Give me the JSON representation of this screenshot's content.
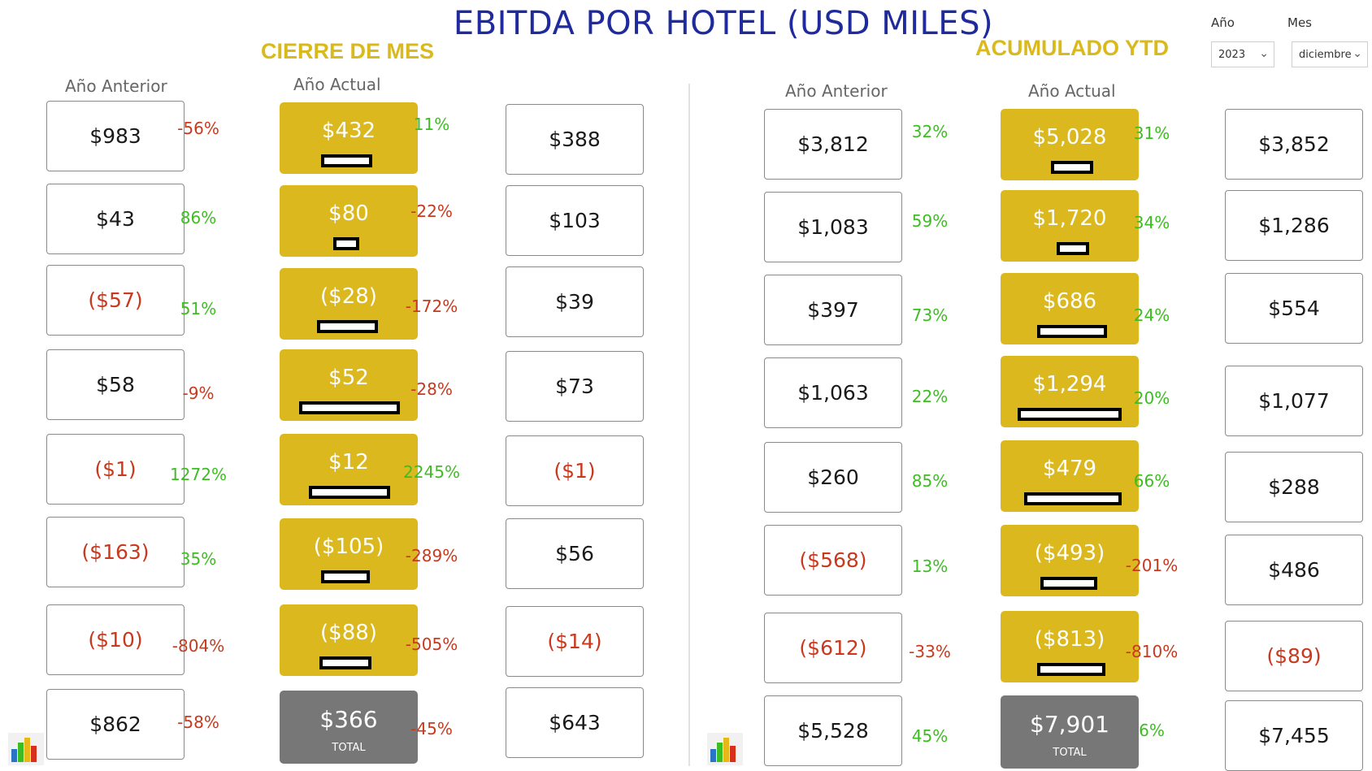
{
  "title": "EBITDA POR HOTEL (USD MILES)",
  "sections": {
    "mes": {
      "title": "CIERRE DE MES",
      "header_prev": "Año Anterior",
      "header_curr": "Año Actual",
      "rows": [
        {
          "prev": "$983",
          "prev_neg": false,
          "pct1": "-56%",
          "pct1_neg": true,
          "curr": "$432",
          "pct2": "11%",
          "pct2_neg": false,
          "right": "$388",
          "right_neg": false
        },
        {
          "prev": "$43",
          "prev_neg": false,
          "pct1": "86%",
          "pct1_neg": false,
          "curr": "$80",
          "pct2": "-22%",
          "pct2_neg": true,
          "right": "$103",
          "right_neg": false
        },
        {
          "prev": "($57)",
          "prev_neg": true,
          "pct1": "51%",
          "pct1_neg": false,
          "curr": "($28)",
          "pct2": "-172%",
          "pct2_neg": true,
          "right": "$39",
          "right_neg": false
        },
        {
          "prev": "$58",
          "prev_neg": false,
          "pct1": "-9%",
          "pct1_neg": true,
          "curr": "$52",
          "pct2": "-28%",
          "pct2_neg": true,
          "right": "$73",
          "right_neg": false
        },
        {
          "prev": "($1)",
          "prev_neg": true,
          "pct1": "1272%",
          "pct1_neg": false,
          "curr": "$12",
          "pct2": "2245%",
          "pct2_neg": false,
          "right": "($1)",
          "right_neg": true
        },
        {
          "prev": "($163)",
          "prev_neg": true,
          "pct1": "35%",
          "pct1_neg": false,
          "curr": "($105)",
          "pct2": "-289%",
          "pct2_neg": true,
          "right": "$56",
          "right_neg": false
        },
        {
          "prev": "($10)",
          "prev_neg": true,
          "pct1": "-804%",
          "pct1_neg": true,
          "curr": "($88)",
          "pct2": "-505%",
          "pct2_neg": true,
          "right": "($14)",
          "right_neg": true
        }
      ],
      "total": {
        "prev": "$862",
        "pct1": "-58%",
        "curr": "$366",
        "label": "TOTAL",
        "pct2": "-45%",
        "right": "$643"
      }
    },
    "ytd": {
      "title": "ACUMULADO YTD",
      "header_prev": "Año Anterior",
      "header_curr": "Año Actual",
      "rows": [
        {
          "prev": "$3,812",
          "prev_neg": false,
          "pct1": "32%",
          "pct1_neg": false,
          "curr": "$5,028",
          "pct2": "31%",
          "pct2_neg": false,
          "right": "$3,852",
          "right_neg": false
        },
        {
          "prev": "$1,083",
          "prev_neg": false,
          "pct1": "59%",
          "pct1_neg": false,
          "curr": "$1,720",
          "pct2": "34%",
          "pct2_neg": false,
          "right": "$1,286",
          "right_neg": false
        },
        {
          "prev": "$397",
          "prev_neg": false,
          "pct1": "73%",
          "pct1_neg": false,
          "curr": "$686",
          "pct2": "24%",
          "pct2_neg": false,
          "right": "$554",
          "right_neg": false
        },
        {
          "prev": "$1,063",
          "prev_neg": false,
          "pct1": "22%",
          "pct1_neg": false,
          "curr": "$1,294",
          "pct2": "20%",
          "pct2_neg": false,
          "right": "$1,077",
          "right_neg": false
        },
        {
          "prev": "$260",
          "prev_neg": false,
          "pct1": "85%",
          "pct1_neg": false,
          "curr": "$479",
          "pct2": "66%",
          "pct2_neg": false,
          "right": "$288",
          "right_neg": false
        },
        {
          "prev": "($568)",
          "prev_neg": true,
          "pct1": "13%",
          "pct1_neg": false,
          "curr": "($493)",
          "pct2": "-201%",
          "pct2_neg": true,
          "right": "$486",
          "right_neg": false
        },
        {
          "prev": "($612)",
          "prev_neg": true,
          "pct1": "-33%",
          "pct1_neg": true,
          "curr": "($813)",
          "pct2": "-810%",
          "pct2_neg": true,
          "right": "($89)",
          "right_neg": true
        }
      ],
      "total": {
        "prev": "$5,528",
        "pct1": "45%",
        "curr": "$7,901",
        "label": "TOTAL",
        "pct2": "6%",
        "right": "$7,455"
      }
    }
  },
  "filters": {
    "year_label": "Año",
    "year_value": "2023",
    "month_label": "Mes",
    "month_value": "diciembre"
  },
  "icons": {
    "chevron": "chevron-down-icon",
    "report": "bar-chart-icon"
  },
  "colors": {
    "title": "#1f2a9c",
    "gold": "#dbb81d",
    "section_title": "#d9b91c",
    "positive": "#3dbd22",
    "negative": "#c8391d",
    "total": "#777777"
  }
}
